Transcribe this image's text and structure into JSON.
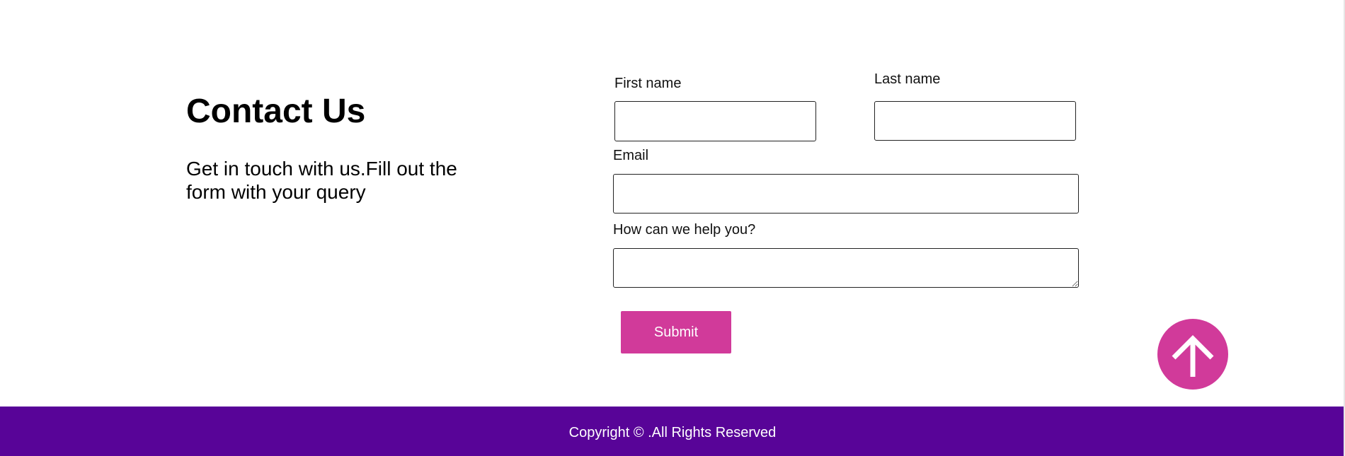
{
  "intro": {
    "title": "Contact Us",
    "text": "Get in touch with us.Fill out the form with your query"
  },
  "form": {
    "first_name_label": "First name",
    "first_name_value": "",
    "last_name_label": "Last name",
    "last_name_value": "",
    "email_label": "Email",
    "email_value": "",
    "message_label": "How can we help you?",
    "message_value": "",
    "submit_label": "Submit"
  },
  "scroll_top": {
    "icon": "arrow-up-icon"
  },
  "footer": {
    "copyright": "Copyright © .All Rights Reserved"
  },
  "colors": {
    "accent": "#d13a9a",
    "footer_bg": "#580498",
    "footer_text": "#ffffff"
  }
}
